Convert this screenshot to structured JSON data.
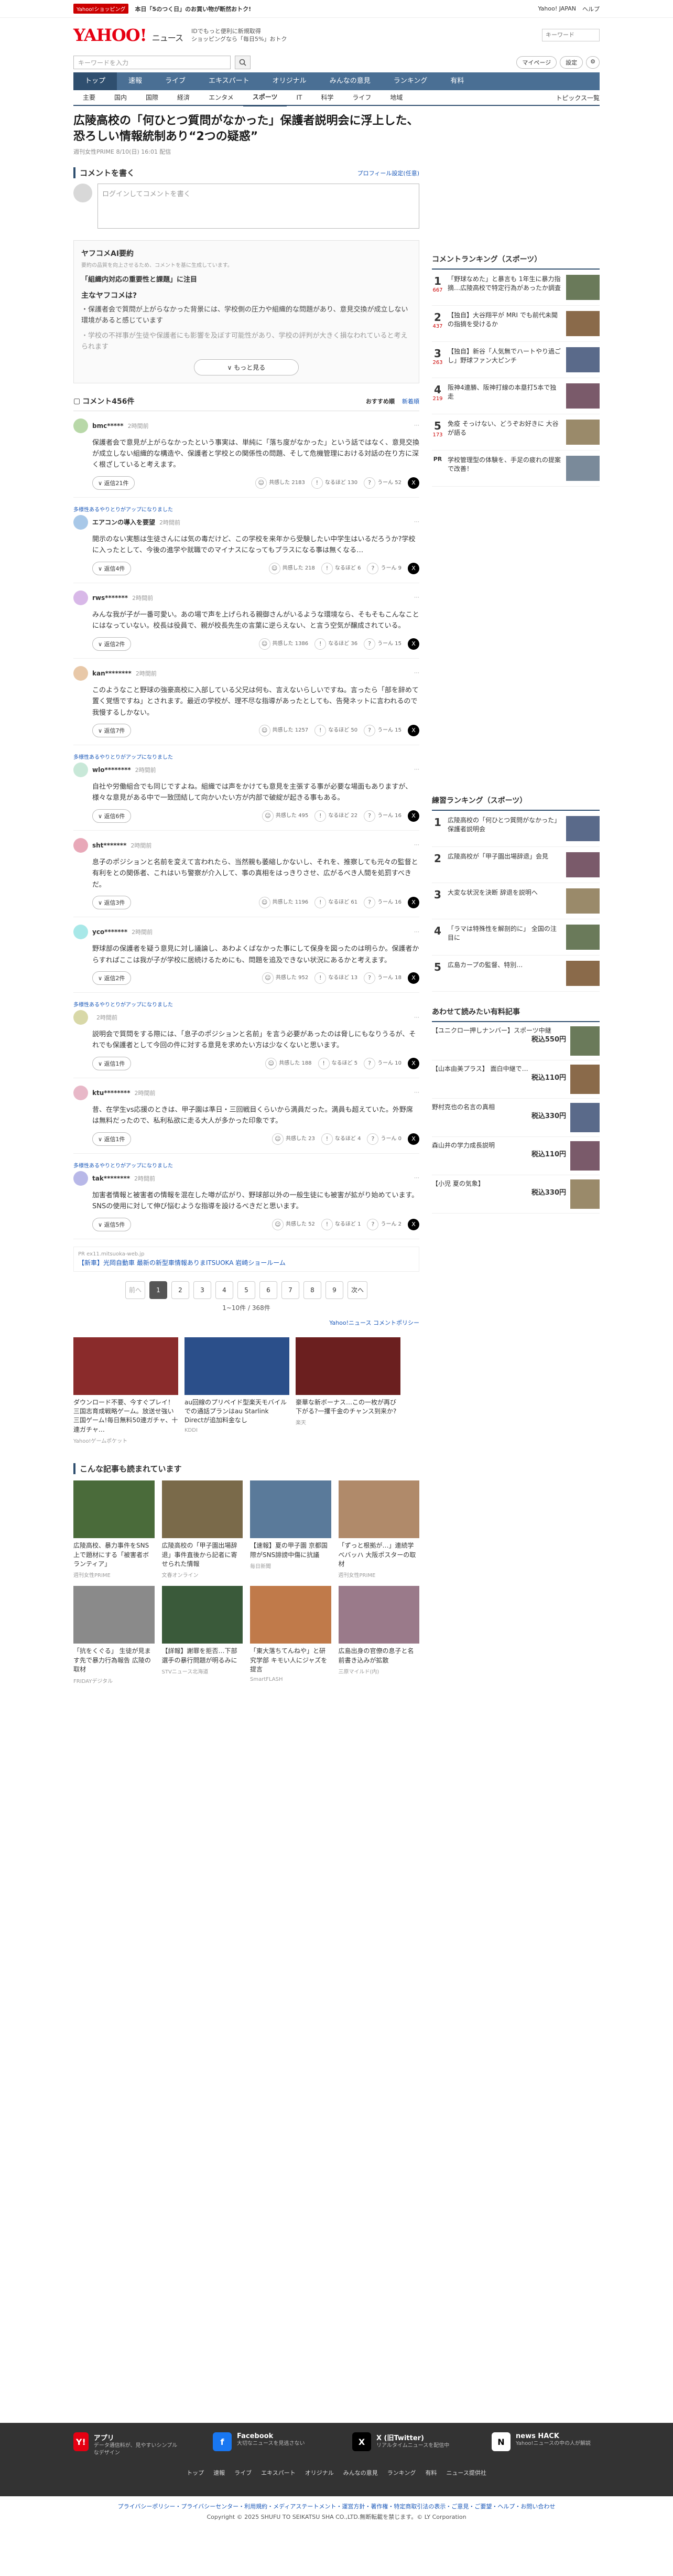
{
  "topbar": {
    "shop_badge": "Yahoo!ショッピング",
    "promo": "本日「5のつく日」のお買い物が断然おトク!",
    "links": [
      "Yahoo! JAPAN",
      "ヘルプ"
    ]
  },
  "header": {
    "logo": "YAHOO!",
    "logo_sub": "ニュース",
    "tagline_1": "IDでもっと便利に新規取得",
    "tagline_2": "ショッピングなら「毎日5%」おトク",
    "search_placeholder": "キーワード"
  },
  "searchrow": {
    "placeholder": "キーワードを入力",
    "mypage": "マイページ",
    "settings": "設定"
  },
  "gnav": [
    "トップ",
    "速報",
    "ライブ",
    "エキスパート",
    "オリジナル",
    "みんなの意見",
    "ランキング",
    "有料"
  ],
  "snav": [
    "主要",
    "国内",
    "国際",
    "経済",
    "エンタメ",
    "スポーツ",
    "IT",
    "科学",
    "ライフ",
    "地域"
  ],
  "snav_right": "トピックス一覧",
  "article": {
    "title": "広陵高校の「何ひとつ質問がなかった」保護者説明会に浮上した、恐ろしい情報統制あり“2つの疑惑”",
    "meta": "週刊女性PRIME 8/10(日) 16:01 配信"
  },
  "comment_input": {
    "heading": "コメントを書く",
    "profile_link": "プロフィール設定(任意)",
    "placeholder": "ログインしてコメントを書く"
  },
  "ai": {
    "heading": "ヤフコメAI要約",
    "note": "要約の品質を向上させるため、コメントを基に生成しています。",
    "topic": "「組織内対応の重要性と課題」に注目",
    "label": "主なヤフコメは?",
    "summary_1": "・保護者会で質問が上がらなかった背景には、学校側の圧力や組織的な問題があり、意見交換が成立しない環境があると感じています",
    "summary_2": "・学校の不祥事が生徒や保護者にも影響を及ぼす可能性があり、学校の評判が大きく損なわれていると考えられます",
    "more": "もっと見る"
  },
  "comments_header": {
    "title": "コメント456件",
    "sort_1": "おすすめ順",
    "sort_2": "新着順"
  },
  "comments": [
    {
      "user": "bmc*****",
      "time": "2時間前",
      "picked": "",
      "body": "保護者会で意見が上がらなかったという事実は、単純に「落ち度がなかった」という話ではなく、意見交換が成立しない組織的な構造や、保護者と学校との関係性の問題、そして危機管理における対話の在り方に深く根ざしていると考えます。",
      "replies": "返信21件",
      "r1": "共感した 2183",
      "r2": "なるほど 130",
      "r3": "うーん 52"
    },
    {
      "user": "エアコンの導入を要望",
      "time": "2時間前",
      "picked": "多様性あるやりとりがアップになりました",
      "body": "開示のない実態は生徒さんには気の毒だけど、この学校を来年から受験したい中学生はいるだろうか?学校に入ったとして、今後の進学や就職でのマイナスになってもプラスになる事は無くなる…",
      "replies": "返信4件",
      "r1": "共感した 218",
      "r2": "なるほど 6",
      "r3": "うーん 9"
    },
    {
      "user": "rws*******",
      "time": "2時間前",
      "picked": "",
      "body": "みんな我が子が一番可愛い。あの場で声を上げられる親御さんがいるような環境なら、そもそもこんなことにはなっていない。校長は役員で、親が校長先生の言葉に逆らえない、と言う空気が醸成されている。",
      "replies": "返信2件",
      "r1": "共感した 1386",
      "r2": "なるほど 36",
      "r3": "うーん 15"
    },
    {
      "user": "kan********",
      "time": "2時間前",
      "picked": "",
      "body": "このようなこと野球の強豪高校に入部している父兄は何も、言えないらしいですね。言ったら「部を辞めて置く覚悟ですね」とされます。最近の学校が、理不尽な指導があったとしても、告発ネットに言われるので我慢するしかない。",
      "replies": "返信7件",
      "r1": "共感した 1257",
      "r2": "なるほど 50",
      "r3": "うーん 15"
    },
    {
      "user": "wlo********",
      "time": "2時間前",
      "picked": "多様性あるやりとりがアップになりました",
      "body": "自社や労働組合でも同じですよね。組織では声をかけても意見を主張する事が必要な場面もありますが、様々な意見がある中で一致団結して向かいたい方が内部で破綻が起きる事もある。",
      "replies": "返信6件",
      "r1": "共感した 495",
      "r2": "なるほど 22",
      "r3": "うーん 16"
    },
    {
      "user": "sht*******",
      "time": "2時間前",
      "picked": "",
      "body": "息子のポジションと名前を変えて言われたら、当然親も萎縮しかないし、それを、推察しても元々の監督と有利をとの関係者、これはいち警察が介入して、事の真相をはっきりさせ、広がるべき人間を処罰すべきだ。",
      "replies": "返信3件",
      "r1": "共感した 1196",
      "r2": "なるほど 61",
      "r3": "うーん 16"
    },
    {
      "user": "yco*******",
      "time": "2時間前",
      "picked": "",
      "body": "野球部の保護者を疑う意見に対し議論し、あわよくばなかった事にして保身を図ったのは明らか。保護者からすればここは我が子が学校に居続けるためにも、問題を追及できない状況にあるかと考えます。",
      "replies": "返信2件",
      "r1": "共感した 952",
      "r2": "なるほど 13",
      "r3": "うーん 18"
    },
    {
      "user": "",
      "time": "2時間前",
      "picked": "多様性あるやりとりがアップになりました",
      "body": "説明会で質問をする際には、「息子のポジションと名前」を言う必要があったのは脅しにもなりうるが、それでも保護者として今回の件に対する意見を求めたい方は少なくないと思います。",
      "replies": "返信1件",
      "r1": "共感した 188",
      "r2": "なるほど 5",
      "r3": "うーん 10"
    },
    {
      "user": "ktu********",
      "time": "2時間前",
      "picked": "",
      "body": "昔、在学生vs応援のときは、甲子園は準日・三回戦目くらいから満員だった。満員も超えていた。外野席は無料だったので、私利私欲に走る大人が多かった印象です。",
      "replies": "返信1件",
      "r1": "共感した 23",
      "r2": "なるほど 4",
      "r3": "うーん 0"
    },
    {
      "user": "tak********",
      "time": "2時間前",
      "picked": "多様性あるやりとりがアップになりました",
      "body": "加害者情報と被害者の情報を混在した噂が広がり、野球部以外の一般生徒にも被害が拡がり始めています。SNSの使用に対して伸び悩むような指導を設けるべきだと思います。",
      "replies": "返信5件",
      "r1": "共感した 52",
      "r2": "なるほど 1",
      "r3": "うーん 2"
    }
  ],
  "ad_banner": {
    "label": "PR",
    "text": "【新車】光岡自動車 最新の新型車情報ありまITSUOKA 岩崎ショールーム",
    "src": "ex11.mitsuoka-web.jp"
  },
  "pager": {
    "prev": "前へ",
    "pages": [
      "1",
      "2",
      "3",
      "4",
      "5",
      "6",
      "7",
      "8",
      "9"
    ],
    "next": "次へ",
    "count": "1~10件 / 368件"
  },
  "ads_link": "Yahoo!ニュース コメントポリシー",
  "ads": [
    {
      "cap": "ダウンロード不要、今すぐプレイ！三国志育成戦略ゲーム。放送せ強い三国ゲーム!毎日無料50連ガチャ、十連ガチャ…",
      "src": "Yahoo!ゲームポケット"
    },
    {
      "cap": "au回線のプリペイド型楽天モバイルでの通話プランはau Starlink Directが追加料金なし",
      "src": "KDDI"
    },
    {
      "cap": "豪華な新ボーナス…この一枚が再び下がる?一攫千金のチャンス到来か?",
      "src": "楽天"
    }
  ],
  "rec_heading": "こんな記事も読まれています",
  "recs": [
    {
      "cap": "広陵高校、暴力事件をSNS上で題材にする「被害者ボランティア」",
      "src": "週刊女性PRIME"
    },
    {
      "cap": "広陵高校の「甲子園出場辞退」事件直後から記者に寄せられた情報",
      "src": "文春オンライン"
    },
    {
      "cap": "【速報】夏の甲子園 京都国際がSNS誹謗中傷に抗議",
      "src": "毎日新聞"
    },
    {
      "cap": "「ずっと根拠が…」連続学べバッハ 大阪ポスターの取材",
      "src": "週刊女性PRIME"
    },
    {
      "cap": "「抗をくぐる」 生徒が見ます先で暴力行為報告 広陵の取材",
      "src": "FRIDAYデジタル"
    },
    {
      "cap": "【詳報】謝罪を拒否…下部選手の暴行問題が明るみに",
      "src": "STVニュース北海道"
    },
    {
      "cap": "「東大落ちてんねや」と研究学部 キモい人にジャズを提言",
      "src": "SmartFLASH"
    },
    {
      "cap": "広島出身の官僚の息子と名前書き込みが拡散",
      "src": "三原マイルド(内)"
    }
  ],
  "side": {
    "ranking_heading": "コメントランキング（スポーツ）",
    "ranks": [
      {
        "n": "1",
        "cc": "667",
        "txt": "「野球なめた」と暴言も 1年生に暴力指摘…広陵高校で特定行為があったか調査"
      },
      {
        "n": "2",
        "cc": "437",
        "txt": "【独自】大谷翔平が MRI でも前代未聞の指摘を受けるか"
      },
      {
        "n": "3",
        "cc": "263",
        "txt": "【独自】新谷「人気無でハートやり過ごし」野球ファン大ピンチ"
      },
      {
        "n": "4",
        "cc": "219",
        "txt": "阪神4連勝、阪神打線の本塁打5本で独走"
      },
      {
        "n": "5",
        "cc": "173",
        "txt": "免疫 そっけない、どうぞお好きに 大谷が語る"
      }
    ],
    "pr_text": "学校管理型の体験を、手足の疲れの提案で改善！",
    "rank2_heading": "練習ランキング（スポーツ）",
    "ranks2": [
      {
        "n": "1",
        "txt": "広陵高校の「何ひとつ質問がなかった」保護者説明会"
      },
      {
        "n": "2",
        "txt": "広陵高校が「甲子園出場辞退」会見"
      },
      {
        "n": "3",
        "txt": "大変な状況を決断 辞退を説明へ"
      },
      {
        "n": "4",
        "txt": "「ラマは特殊性を解剖的に」 全国の注目に"
      },
      {
        "n": "5",
        "txt": "広島カープの監督、特別…"
      }
    ],
    "shop_heading": "あわせて読みたい有料記事",
    "shop": [
      {
        "txt": "【ユニクロ一押しナンバー】スポーツ中継",
        "price": "税込550円"
      },
      {
        "txt": "【山本由美プラス】 面白中継で…",
        "price": "税込110円"
      },
      {
        "txt": "野村克也の名言の真相",
        "price": "税込330円"
      },
      {
        "txt": "森山井の学力成長説明",
        "price": "税込110円"
      },
      {
        "txt": "【小児 夏の気象】",
        "price": "税込330円"
      }
    ]
  },
  "footer": {
    "apps": [
      {
        "t": "アプリ",
        "d": "データ通信料が、見やすいシンプルなデザイン"
      },
      {
        "t": "Facebook",
        "d": "大切なニュースを見逃さない"
      },
      {
        "t": "X (旧Twitter)",
        "d": "リアルタイムニュースを配信中"
      },
      {
        "t": "news HACK",
        "d": "Yahoo!ニュースの中の人が解説"
      }
    ],
    "nav": [
      "トップ",
      "速報",
      "ライブ",
      "エキスパート",
      "オリジナル",
      "みんなの意見",
      "ランキング",
      "有料",
      "ニュース提供社"
    ],
    "links": "プライバシーポリシー・プライバシーセンター・利用規約・メディアステートメント・運営方針・著作権・特定商取引法の表示・ご意見・ご要望・ヘルプ・お問い合わせ",
    "copyright": "Copyright © 2025 SHUFU TO SEIKATSU SHA CO.,LTD.無断転載を禁じます。© LY Corporation"
  }
}
